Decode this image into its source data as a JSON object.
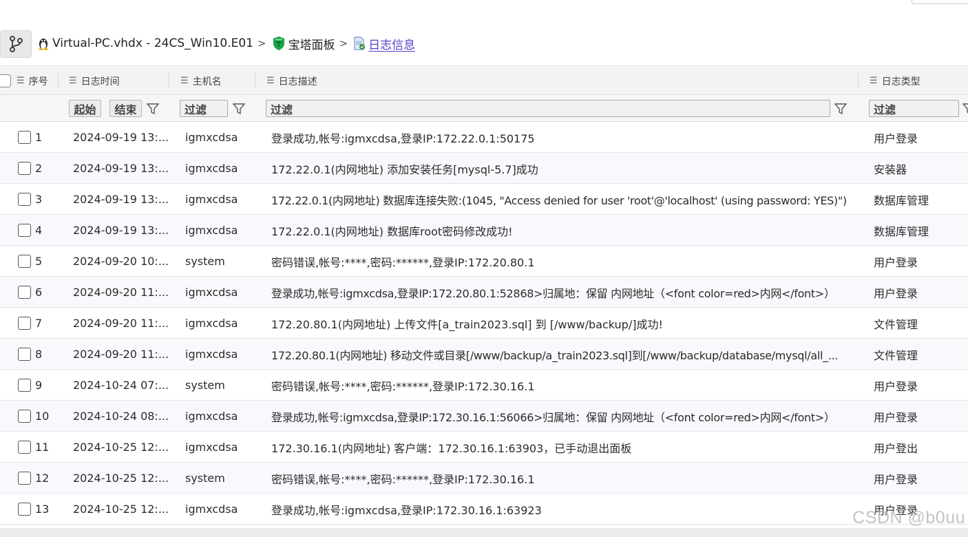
{
  "breadcrumb": {
    "items": [
      {
        "label": "Virtual-PC.vhdx - 24CS_Win10.E01",
        "icon": "linux-penguin-icon"
      },
      {
        "label": "宝塔面板",
        "icon": "baota-shield-icon"
      },
      {
        "label": "日志信息",
        "icon": "log-file-icon"
      }
    ],
    "separator": ">"
  },
  "table": {
    "columns": [
      {
        "key": "seq",
        "label": "序号"
      },
      {
        "key": "time",
        "label": "日志时间"
      },
      {
        "key": "host",
        "label": "主机名"
      },
      {
        "key": "desc",
        "label": "日志描述"
      },
      {
        "key": "type",
        "label": "日志类型"
      }
    ],
    "filters": {
      "start_label": "起始",
      "end_label": "结束",
      "filter_placeholder": "过滤"
    },
    "rows": [
      {
        "seq": "1",
        "time": "2024-09-19 13:...",
        "host": "igmxcdsa",
        "desc": "登录成功,帐号:igmxcdsa,登录IP:172.22.0.1:50175",
        "type": "用户登录"
      },
      {
        "seq": "2",
        "time": "2024-09-19 13:...",
        "host": "igmxcdsa",
        "desc": "172.22.0.1(内网地址) 添加安装任务[mysql-5.7]成功",
        "type": "安装器"
      },
      {
        "seq": "3",
        "time": "2024-09-19 13:...",
        "host": "igmxcdsa",
        "desc": "172.22.0.1(内网地址) 数据库连接失败:(1045, \"Access denied for user 'root'@'localhost' (using password: YES)\")",
        "type": "数据库管理"
      },
      {
        "seq": "4",
        "time": "2024-09-19 13:...",
        "host": "igmxcdsa",
        "desc": "172.22.0.1(内网地址) 数据库root密码修改成功!",
        "type": "数据库管理"
      },
      {
        "seq": "5",
        "time": "2024-09-20 10:...",
        "host": "system",
        "desc": "密码错误,帐号:****,密码:******,登录IP:172.20.80.1",
        "type": "用户登录"
      },
      {
        "seq": "6",
        "time": "2024-09-20 11:...",
        "host": "igmxcdsa",
        "desc": "登录成功,帐号:igmxcdsa,登录IP:172.20.80.1:52868>归属地：保留 内网地址（<font color=red>内网</font>）",
        "type": "用户登录"
      },
      {
        "seq": "7",
        "time": "2024-09-20 11:...",
        "host": "igmxcdsa",
        "desc": "172.20.80.1(内网地址) 上传文件[a_train2023.sql] 到 [/www/backup/]成功!",
        "type": "文件管理"
      },
      {
        "seq": "8",
        "time": "2024-09-20 11:...",
        "host": "igmxcdsa",
        "desc": "172.20.80.1(内网地址) 移动文件或目录[/www/backup/a_train2023.sql]到[/www/backup/database/mysql/all_...",
        "type": "文件管理"
      },
      {
        "seq": "9",
        "time": "2024-10-24 07:...",
        "host": "system",
        "desc": "密码错误,帐号:****,密码:******,登录IP:172.30.16.1",
        "type": "用户登录"
      },
      {
        "seq": "10",
        "time": "2024-10-24 08:...",
        "host": "igmxcdsa",
        "desc": "登录成功,帐号:igmxcdsa,登录IP:172.30.16.1:56066>归属地：保留 内网地址（<font color=red>内网</font>）",
        "type": "用户登录"
      },
      {
        "seq": "11",
        "time": "2024-10-25 12:...",
        "host": "igmxcdsa",
        "desc": "172.30.16.1(内网地址) 客户端：172.30.16.1:63903，已手动退出面板",
        "type": "用户登出"
      },
      {
        "seq": "12",
        "time": "2024-10-25 12:...",
        "host": "system",
        "desc": "密码错误,帐号:****,密码:******,登录IP:172.30.16.1",
        "type": "用户登录"
      },
      {
        "seq": "13",
        "time": "2024-10-25 12:...",
        "host": "igmxcdsa",
        "desc": "登录成功,帐号:igmxcdsa,登录IP:172.30.16.1:63923",
        "type": "用户登录"
      }
    ]
  },
  "watermark": "CSDN @b0uu",
  "colors": {
    "link": "#5a3fc9",
    "header_bg": "#f3f3f3",
    "alt_row": "#f7f9fc",
    "baota_green": "#1aa34a"
  }
}
